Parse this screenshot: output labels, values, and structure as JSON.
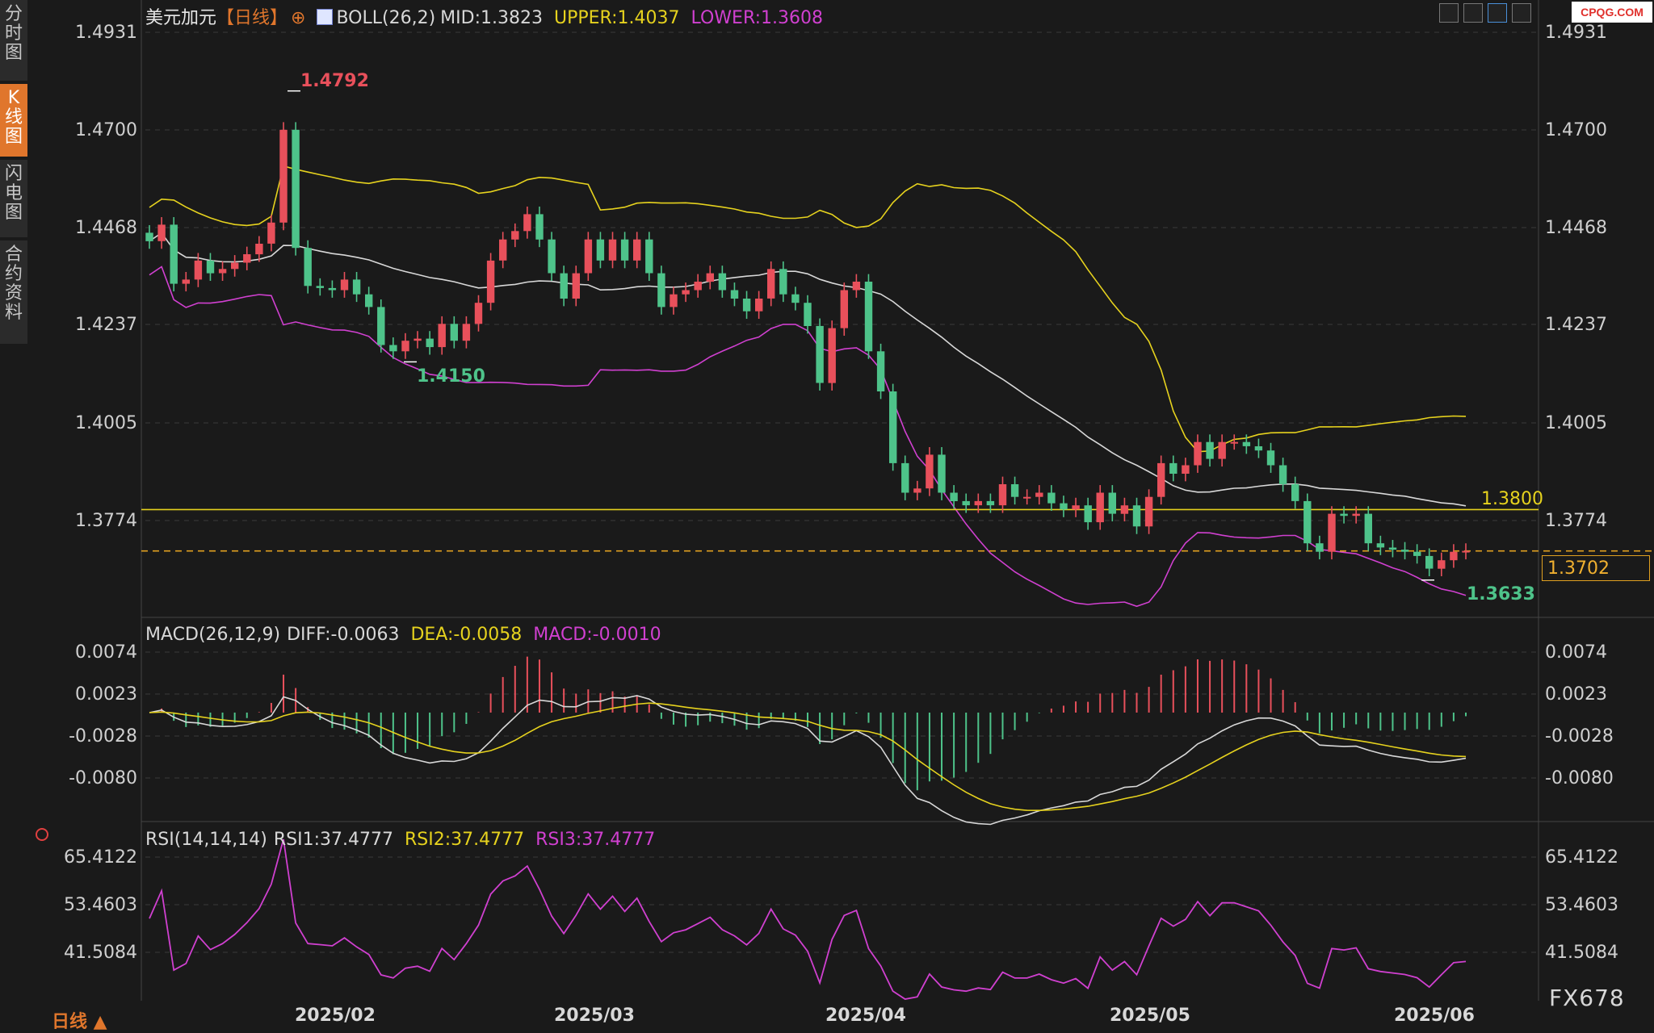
{
  "sidebar": {
    "tabs": [
      {
        "label": "分时图",
        "active": false
      },
      {
        "label": "K线图",
        "active": true
      },
      {
        "label": "闪电图",
        "active": false
      },
      {
        "label": "合约资料",
        "active": false
      }
    ]
  },
  "header": {
    "symbol": "美元加元",
    "period": "【日线】",
    "boll_label": "BOLL(26,2)",
    "boll_mid": "MID:1.3823",
    "boll_upper": "UPPER:1.4037",
    "boll_lower": "LOWER:1.3608",
    "logo": "CPQG.COM"
  },
  "macd_header": {
    "label": "MACD(26,12,9)",
    "diff": "DIFF:-0.0063",
    "dea": "DEA:-0.0058",
    "macd": "MACD:-0.0010"
  },
  "rsi_header": {
    "label": "RSI(14,14,14)",
    "rsi1": "RSI1:37.4777",
    "rsi2": "RSI2:37.4777",
    "rsi3": "RSI3:37.4777"
  },
  "price_axis": [
    "1.4931",
    "1.4700",
    "1.4468",
    "1.4237",
    "1.4005",
    "1.3774"
  ],
  "macd_axis": [
    "0.0074",
    "0.0023",
    "-0.0028",
    "-0.0080"
  ],
  "rsi_axis": [
    "65.4122",
    "53.4603",
    "41.5084"
  ],
  "dates": [
    "2025/02",
    "2025/03",
    "2025/04",
    "2025/05",
    "2025/06"
  ],
  "annotations": {
    "high": "1.4792",
    "low1": "1.4150",
    "low2": "1.3633",
    "hline": "1.3800",
    "current_price": "1.3702"
  },
  "footer": {
    "period_button": "日线 ▲",
    "brand": "FX678"
  },
  "colors": {
    "up": "#e8505b",
    "down": "#4ec38a",
    "upper": "#e6d21e",
    "mid": "#d8d8d8",
    "lower": "#d040d0",
    "hline": "#e6d21e",
    "current": "#e0a020"
  },
  "chart_data": {
    "type": "candlestick",
    "title": "美元加元 【日线】",
    "ylim": [
      1.3633,
      1.4931
    ],
    "closes": [
      1.4436,
      1.4475,
      1.4335,
      1.4345,
      1.439,
      1.436,
      1.437,
      1.4385,
      1.4405,
      1.443,
      1.448,
      1.47,
      1.442,
      1.433,
      1.4325,
      1.432,
      1.4345,
      1.431,
      1.428,
      1.419,
      1.4175,
      1.42,
      1.4205,
      1.4185,
      1.424,
      1.42,
      1.424,
      1.429,
      1.439,
      1.444,
      1.446,
      1.45,
      1.444,
      1.436,
      1.43,
      1.436,
      1.444,
      1.439,
      1.444,
      1.439,
      1.444,
      1.436,
      1.428,
      1.431,
      1.432,
      1.434,
      1.436,
      1.432,
      1.43,
      1.427,
      1.43,
      1.437,
      1.431,
      1.429,
      1.4235,
      1.41,
      1.423,
      1.432,
      1.434,
      1.4175,
      1.408,
      1.391,
      1.384,
      1.385,
      1.393,
      1.384,
      1.382,
      1.381,
      1.382,
      1.381,
      1.386,
      1.383,
      1.383,
      1.384,
      1.3815,
      1.38,
      1.381,
      1.377,
      1.384,
      1.379,
      1.381,
      1.376,
      1.383,
      1.391,
      1.3885,
      1.3905,
      1.396,
      1.392,
      1.396,
      1.396,
      1.395,
      1.394,
      1.3905,
      1.386,
      1.382,
      1.372,
      1.37,
      1.379,
      1.3785,
      1.379,
      1.372,
      1.371,
      1.3705,
      1.37,
      1.369,
      1.366,
      1.368,
      1.37,
      1.3702
    ]
  }
}
